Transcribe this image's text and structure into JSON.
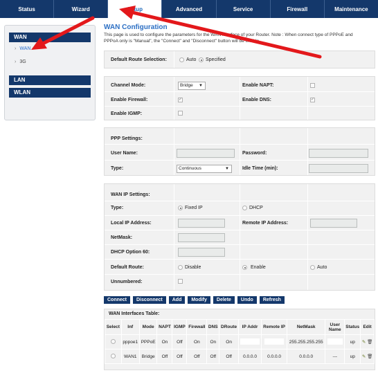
{
  "nav": {
    "tabs": [
      "Status",
      "Wizard",
      "Setup",
      "Advanced",
      "Service",
      "Firewall",
      "Maintenance"
    ],
    "active": "Setup"
  },
  "sidebar": {
    "wan": "WAN",
    "wan_items": [
      "WAN",
      "3G"
    ],
    "lan": "LAN",
    "wlan": "WLAN"
  },
  "page": {
    "title": "WAN Configuration",
    "desc1": "This page is used to configure the parameters for the WAN interface of your Router. Note : When connect type of PPPoE and",
    "desc2": "PPPoA only is \"Manual\", the \"Connect\" and \"Disconnect\" button will be enable."
  },
  "route": {
    "label": "Default Route Selection:",
    "auto": "Auto",
    "specified": "Specified",
    "selected": "Specified"
  },
  "channel": {
    "mode_label": "Channel Mode:",
    "mode_value": "Bridge",
    "napt_label": "Enable NAPT:",
    "firewall_label": "Enable Firewall:",
    "dns_label": "Enable DNS:",
    "igmp_label": "Enable IGMP:"
  },
  "ppp": {
    "section": "PPP Settings:",
    "user_label": "User Name:",
    "password_label": "Password:",
    "type_label": "Type:",
    "type_value": "Continuous",
    "idle_label": "Idle Time (min):"
  },
  "wanip": {
    "section": "WAN IP Settings:",
    "type_label": "Type:",
    "fixed_ip": "Fixed IP",
    "dhcp": "DHCP",
    "local_ip_label": "Local IP Address:",
    "remote_ip_label": "Remote IP Address:",
    "netmask_label": "NetMask:",
    "dhcp60_label": "DHCP Option 60:",
    "default_route_label": "Default Route:",
    "disable": "Disable",
    "enable": "Enable",
    "auto": "Auto",
    "unnumbered_label": "Unnumbered:"
  },
  "buttons": [
    "Connect",
    "Disconnect",
    "Add",
    "Modify",
    "Delete",
    "Undo",
    "Refresh"
  ],
  "table": {
    "title": "WAN Interfaces Table:",
    "headers": [
      "Select",
      "Inf",
      "Mode",
      "NAPT",
      "IGMP",
      "Firewall",
      "DNS",
      "DRoute",
      "IP Addr",
      "Remote IP",
      "NetMask",
      "User Name",
      "Status",
      "Edit"
    ],
    "rows": [
      [
        "",
        "pppoe1",
        "PPPoE",
        "On",
        "Off",
        "On",
        "On",
        "On",
        "",
        "",
        "255.255.255.255",
        "",
        "up",
        ""
      ],
      [
        "",
        "WAN1",
        "Bridge",
        "Off",
        "Off",
        "Off",
        "Off",
        "Off",
        "0.0.0.0",
        "0.0.0.0",
        "0.0.0.0",
        "---",
        "up",
        ""
      ]
    ]
  }
}
